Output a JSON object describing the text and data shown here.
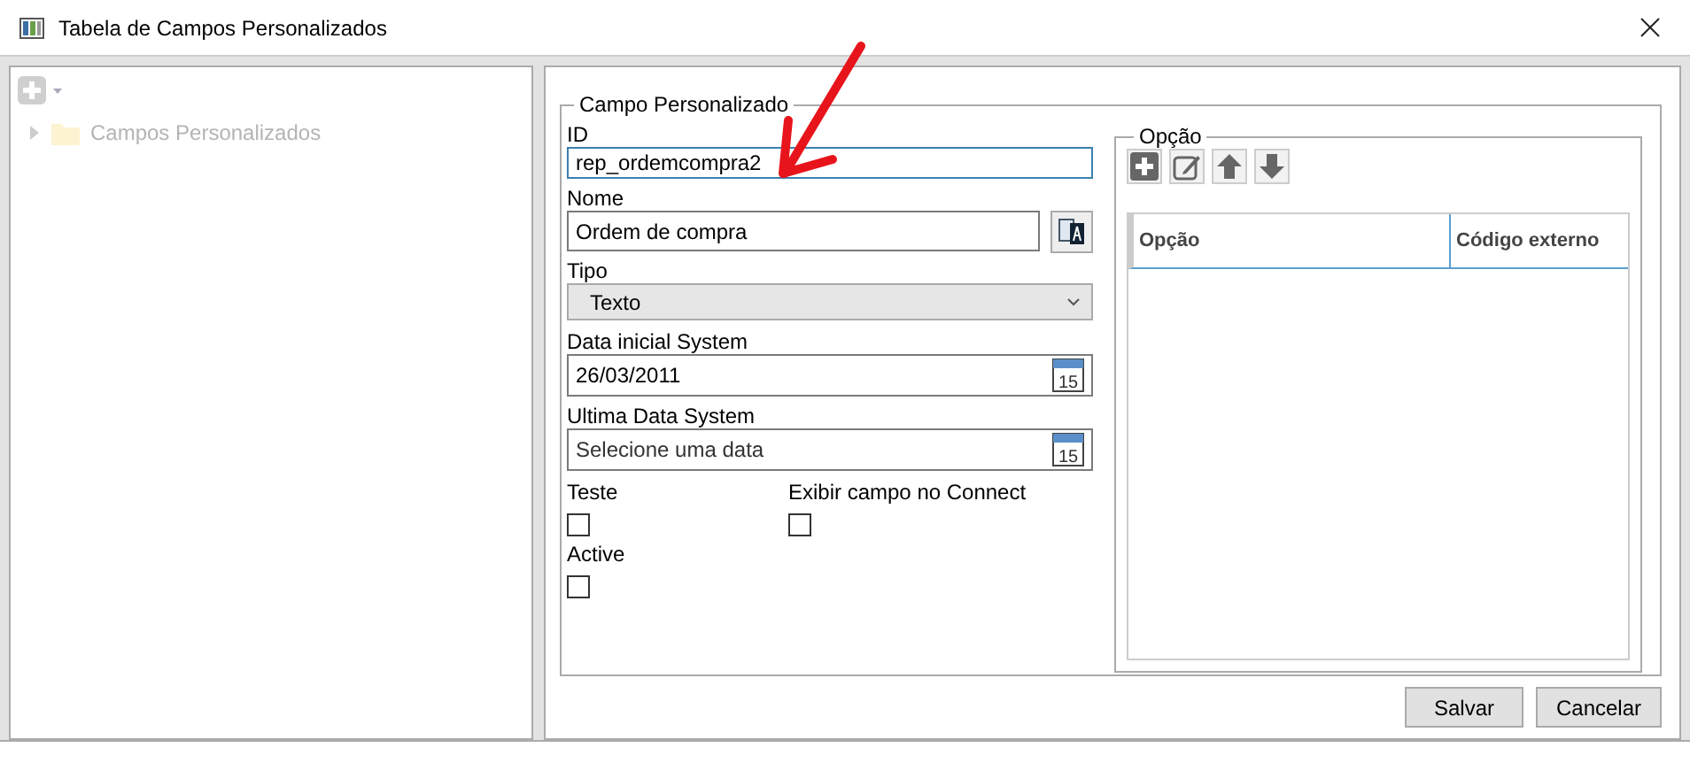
{
  "window": {
    "title": "Tabela de Campos Personalizados"
  },
  "tree": {
    "items": [
      {
        "label": "Campos Personalizados",
        "expanded": false
      }
    ]
  },
  "form": {
    "title": "Campo Personalizado",
    "fields": [
      {
        "kind": "text",
        "label": "ID",
        "value": "rep_ordemcompra2",
        "focused": true
      },
      {
        "kind": "translatable",
        "label": "Nome",
        "value": "Ordem de compra",
        "focused": false
      },
      {
        "kind": "dropdown",
        "label": "Tipo",
        "value": "Texto",
        "focused": false
      },
      {
        "kind": "date",
        "label": "Data inicial System",
        "value": "26/03/2011",
        "calendar_day": "15",
        "focused": false
      },
      {
        "kind": "date",
        "label": "Ultima Data System",
        "placeholder": "Selecione uma data",
        "calendar_day": "15",
        "focused": false
      }
    ],
    "checkboxes": [
      {
        "label": "Teste",
        "checked": false
      },
      {
        "label": "Exibir campo no Connect",
        "checked": false
      },
      {
        "label": "Active",
        "checked": false
      }
    ]
  },
  "options": {
    "title": "Opção",
    "columns": [
      "Opção",
      "Código externo"
    ]
  },
  "buttons": [
    "Salvar",
    "Cancelar"
  ]
}
